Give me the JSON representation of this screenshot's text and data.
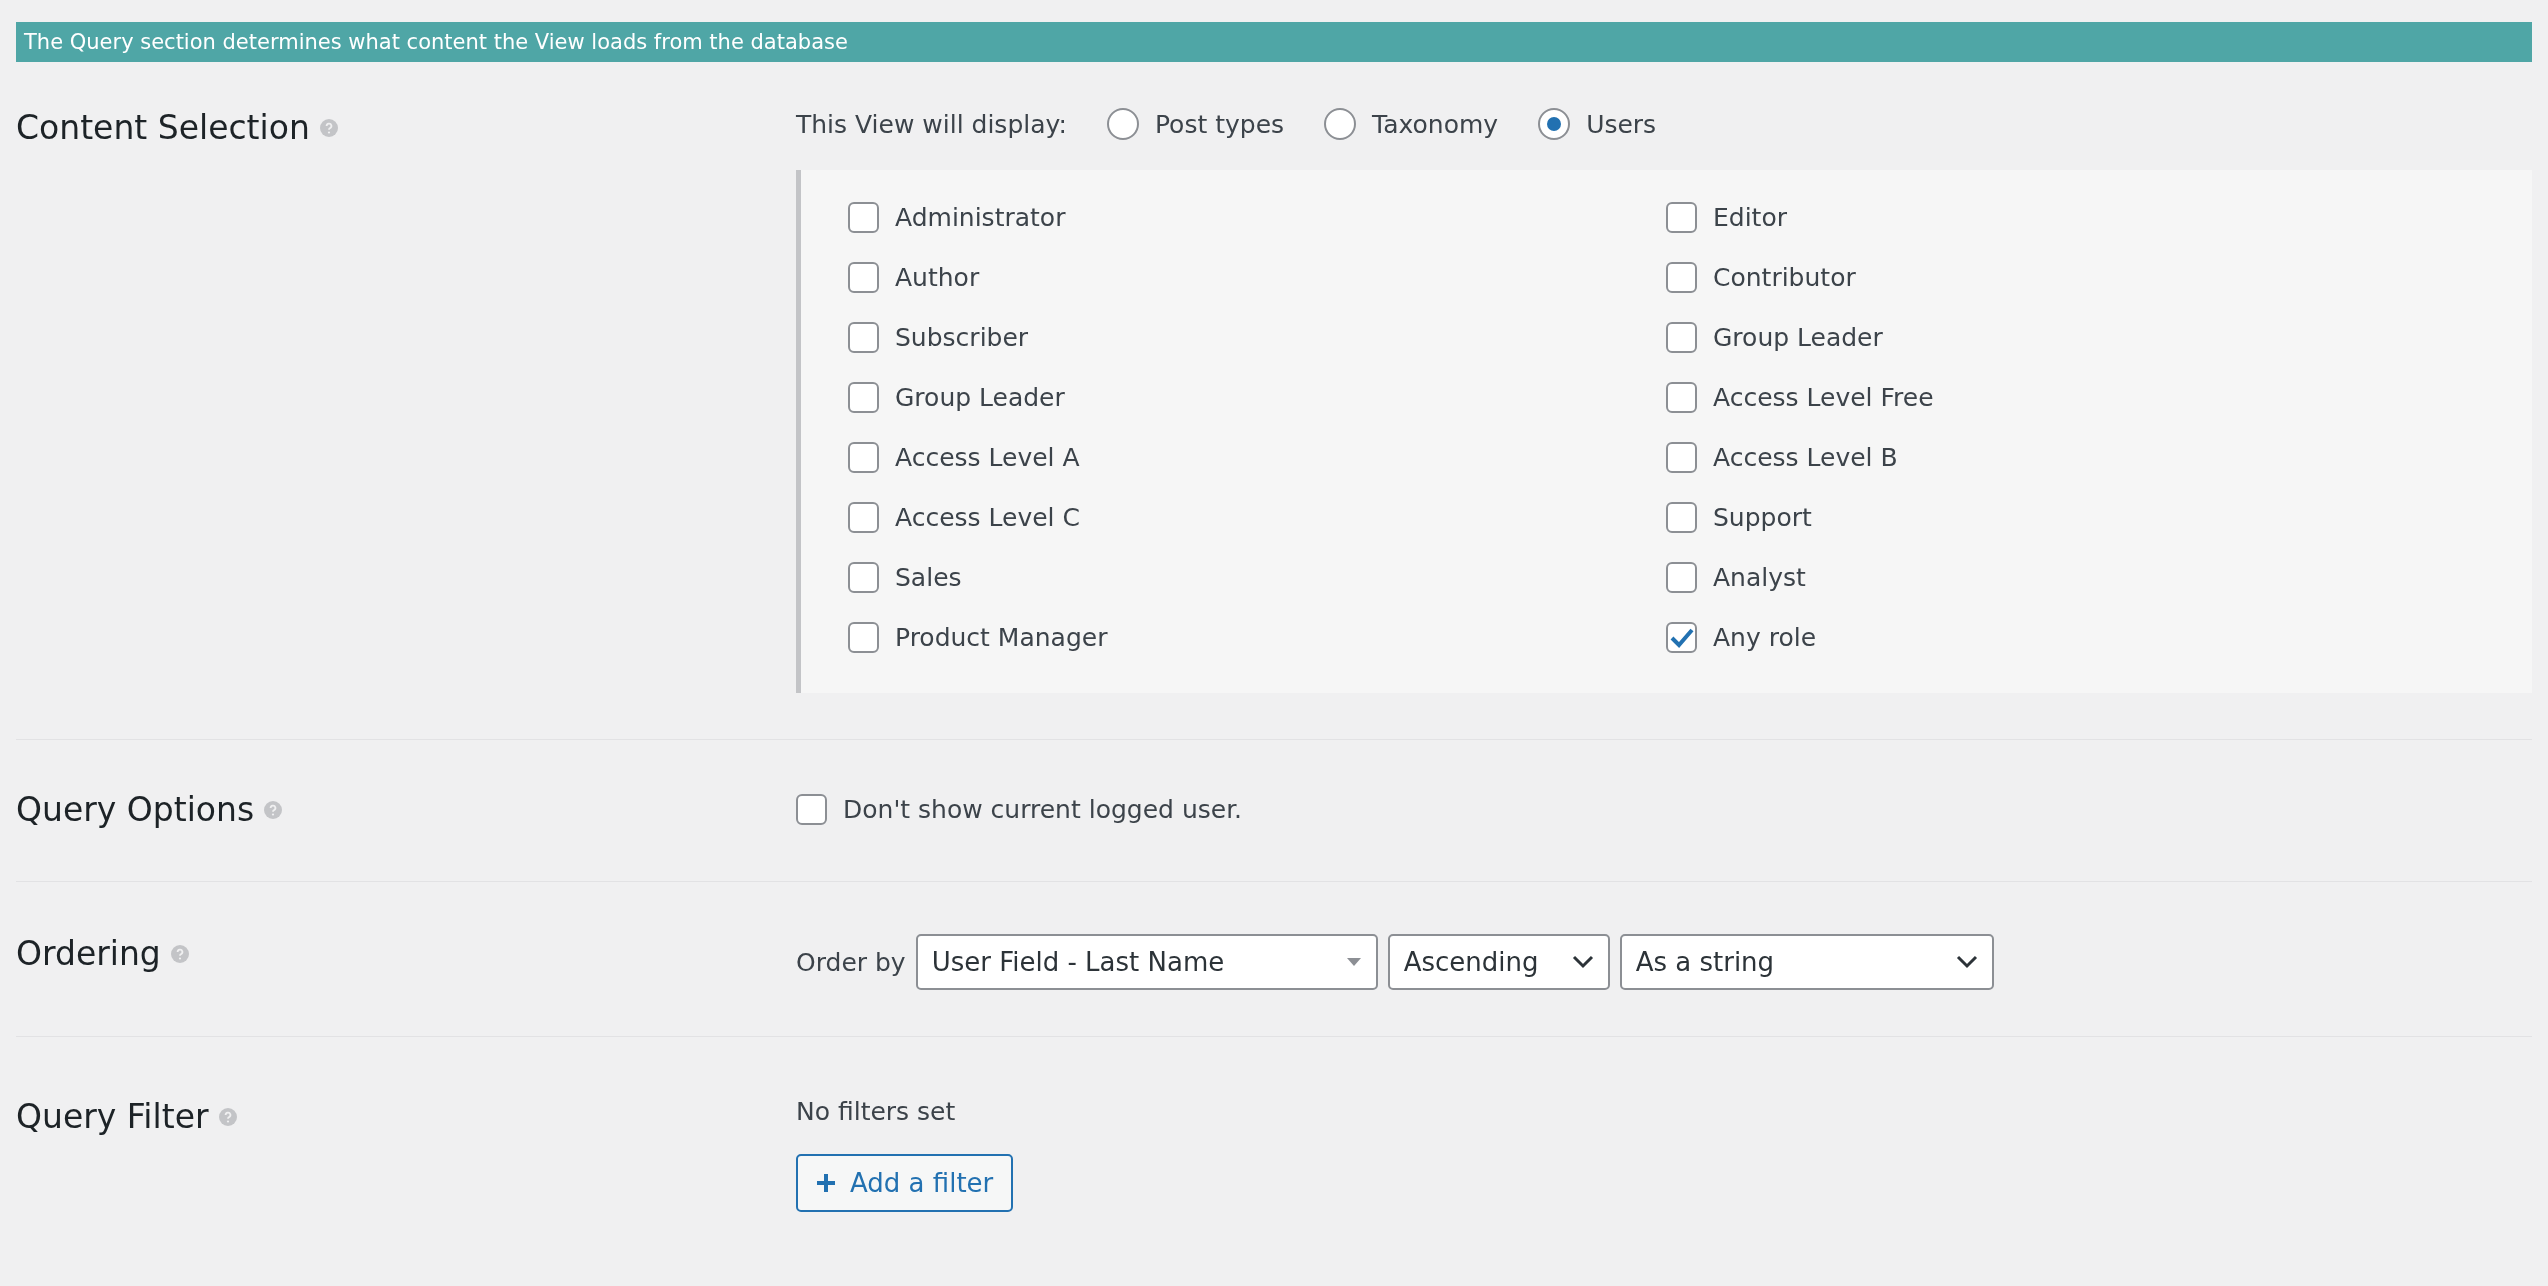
{
  "banner": "The Query section determines what content the View loads from the database",
  "sections": [
    {
      "kind": "content",
      "title": "Content Selection",
      "display_label": "This View will display:",
      "radios": [
        {
          "label": "Post types",
          "selected": false
        },
        {
          "label": "Taxonomy",
          "selected": false
        },
        {
          "label": "Users",
          "selected": true
        }
      ],
      "roles": [
        {
          "label": "Administrator",
          "checked": false
        },
        {
          "label": "Editor",
          "checked": false
        },
        {
          "label": "Author",
          "checked": false
        },
        {
          "label": "Contributor",
          "checked": false
        },
        {
          "label": "Subscriber",
          "checked": false
        },
        {
          "label": "Group Leader",
          "checked": false
        },
        {
          "label": "Group Leader",
          "checked": false
        },
        {
          "label": "Access Level Free",
          "checked": false
        },
        {
          "label": "Access Level A",
          "checked": false
        },
        {
          "label": "Access Level B",
          "checked": false
        },
        {
          "label": "Access Level C",
          "checked": false
        },
        {
          "label": "Support",
          "checked": false
        },
        {
          "label": "Sales",
          "checked": false
        },
        {
          "label": "Analyst",
          "checked": false
        },
        {
          "label": "Product Manager",
          "checked": false
        },
        {
          "label": "Any role",
          "checked": true
        }
      ]
    },
    {
      "kind": "options",
      "title": "Query Options",
      "option": {
        "label": "Don't show current logged user.",
        "checked": false
      }
    },
    {
      "kind": "ordering",
      "title": "Ordering",
      "label": "Order by",
      "selects": [
        {
          "value": "User Field - Last Name",
          "kind": "triangle"
        },
        {
          "value": "Ascending",
          "kind": "chevron"
        },
        {
          "value": "As a string",
          "kind": "chevron"
        }
      ]
    },
    {
      "kind": "filter",
      "title": "Query Filter",
      "status": "No filters set",
      "button": "Add a filter"
    }
  ]
}
